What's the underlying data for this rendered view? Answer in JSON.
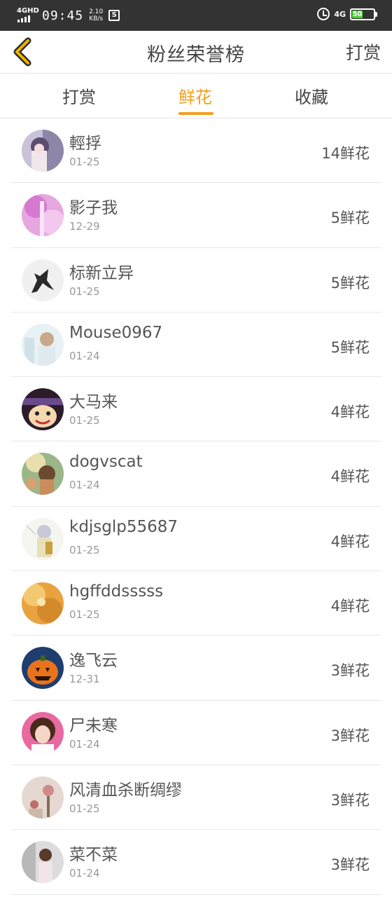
{
  "status_bar": {
    "network": "4GHD",
    "time": "09:45",
    "speed_value": "2.10",
    "speed_unit": "KB/s",
    "app_icon": "S",
    "network_right": "4G",
    "battery": "50",
    "battery_level": 0.5
  },
  "nav": {
    "back_icon": "chevron-left-icon",
    "title": "粉丝荣誉榜",
    "action": "打赏"
  },
  "tabs": [
    {
      "label": "打赏"
    },
    {
      "label": "鲜花"
    },
    {
      "label": "收藏"
    }
  ],
  "active_tab": 1,
  "accent_color": "#f0a020",
  "list": [
    {
      "name": "輕捊",
      "date": "01-25",
      "amount": "14鲜花"
    },
    {
      "name": "影子我",
      "date": "12-29",
      "amount": "5鲜花"
    },
    {
      "name": "标新立异",
      "date": "01-25",
      "amount": "5鲜花"
    },
    {
      "name": "Mouse0967",
      "date": "01-24",
      "amount": "5鲜花"
    },
    {
      "name": "大马来",
      "date": "01-25",
      "amount": "4鲜花"
    },
    {
      "name": "dogvscat",
      "date": "01-24",
      "amount": "4鲜花"
    },
    {
      "name": "kdjsglp55687",
      "date": "01-25",
      "amount": "4鲜花"
    },
    {
      "name": "hgffddsssss",
      "date": "01-25",
      "amount": "4鲜花"
    },
    {
      "name": "逸飞云",
      "date": "12-31",
      "amount": "3鲜花"
    },
    {
      "name": "尸未寒",
      "date": "01-24",
      "amount": "3鲜花"
    },
    {
      "name": "风清血杀断绸缪",
      "date": "01-25",
      "amount": "3鲜花"
    },
    {
      "name": "菜不菜",
      "date": "01-24",
      "amount": "3鲜花"
    }
  ]
}
